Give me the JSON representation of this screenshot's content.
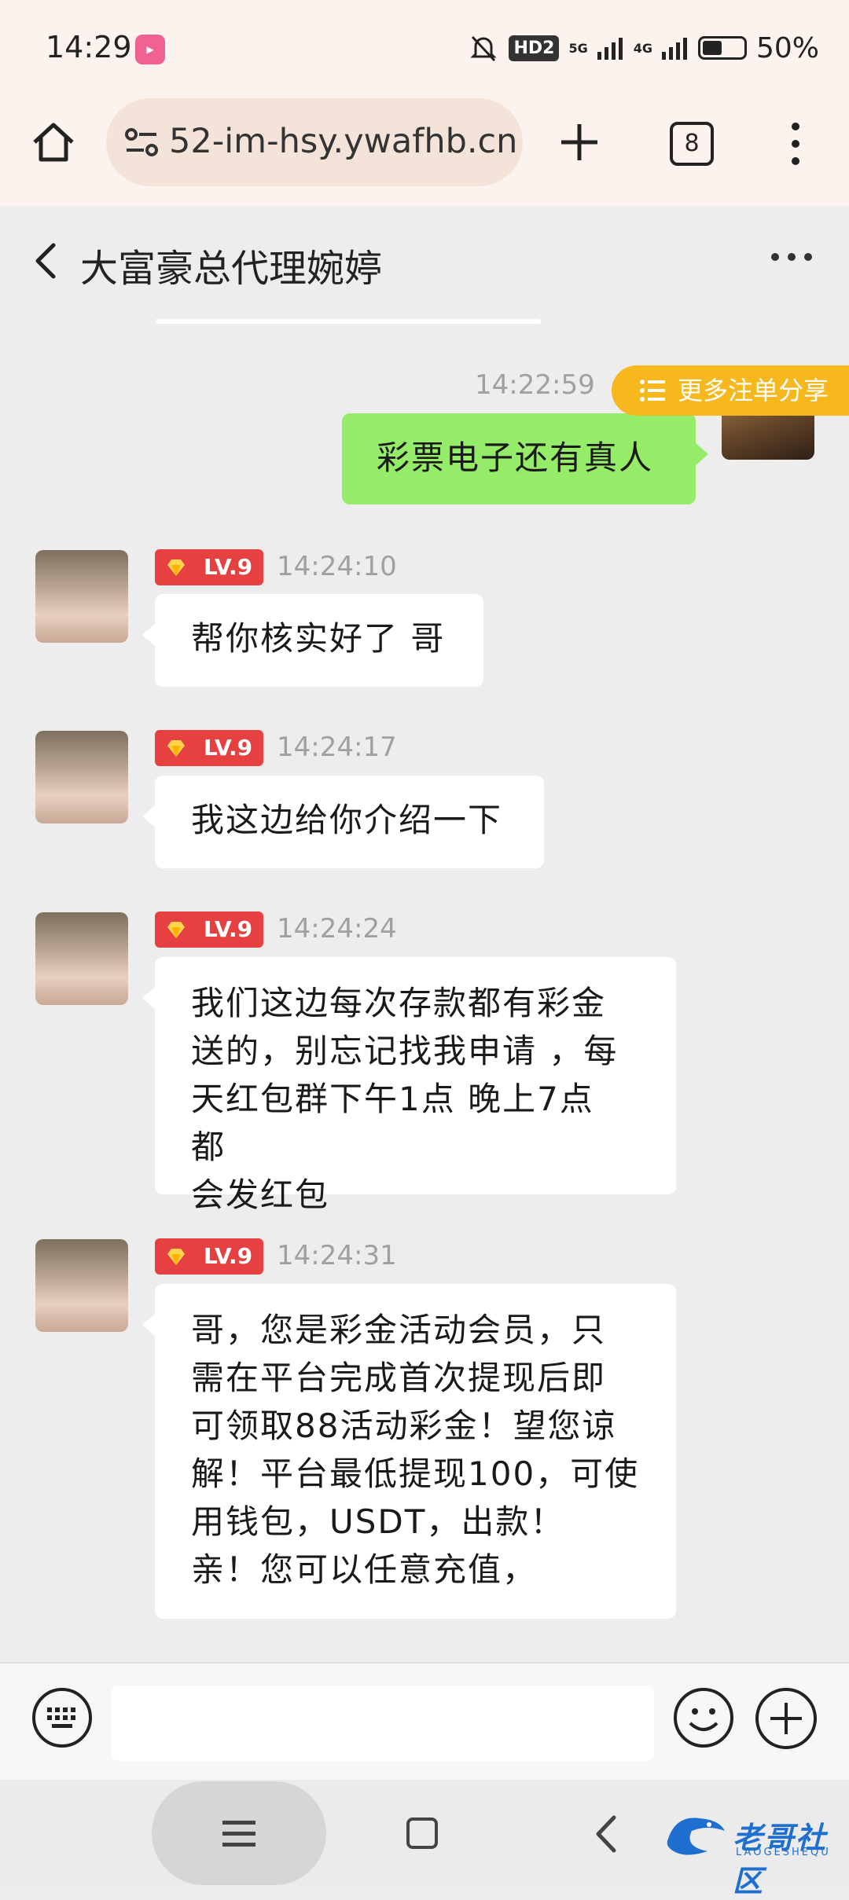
{
  "status_bar": {
    "time": "14:29",
    "hd_label": "HD2",
    "signal_5g": "5G",
    "signal_4g": "4G",
    "battery_percent": "50%"
  },
  "browser": {
    "url": "52-im-hsy.ywafhb.cn",
    "tab_count": "8"
  },
  "chat": {
    "title": "大富豪总代理婉婷"
  },
  "share_button": {
    "label": "更多注单分享"
  },
  "messages": [
    {
      "sender": "self",
      "time": "14:22:59",
      "text": "彩票电子还有真人"
    },
    {
      "sender": "other",
      "level": "LV.9",
      "time": "14:24:10",
      "text": "帮你核实好了 哥"
    },
    {
      "sender": "other",
      "level": "LV.9",
      "time": "14:24:17",
      "text": "我这边给你介绍一下"
    },
    {
      "sender": "other",
      "level": "LV.9",
      "time": "14:24:24",
      "lines": [
        "我们这边每次存款都有彩金",
        "送的，别忘记找我申请 ，每",
        "天红包群下午1点 晚上7点 都",
        "会发红包"
      ]
    },
    {
      "sender": "other",
      "level": "LV.9",
      "time": "14:24:31",
      "lines": [
        "哥，您是彩金活动会员，只",
        "需在平台完成首次提现后即",
        "可领取88活动彩金！望您谅",
        "解！平台最低提现100，可使",
        "用钱包，USDT，出款！",
        "亲！您可以任意充值，"
      ]
    }
  ],
  "input": {
    "value": ""
  },
  "watermark": {
    "text": "老哥社区",
    "sub": "LAOGESHEQU"
  },
  "colors": {
    "self_bubble": "#95ec69",
    "level_badge": "#e64040",
    "share_pill": "#f6b81c"
  }
}
